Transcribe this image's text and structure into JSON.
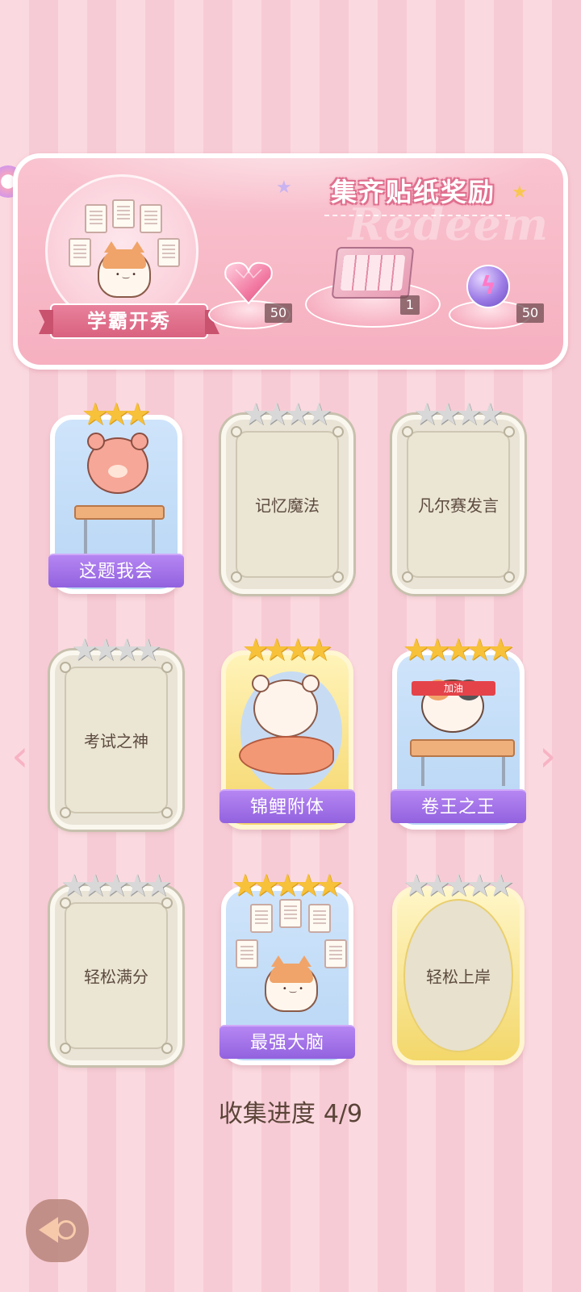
{
  "reward_panel": {
    "title": "集齐贴纸奖励",
    "watermark": "Redeem",
    "featured_sticker_label": "学霸开秀",
    "rewards": [
      {
        "icon": "heart-gem-icon",
        "quantity": "50"
      },
      {
        "icon": "gift-box-icon",
        "quantity": "1"
      },
      {
        "icon": "lightning-orb-icon",
        "quantity": "50"
      }
    ]
  },
  "cards": [
    {
      "label": "这题我会",
      "stars_total": 3,
      "stars_filled": 3,
      "unlocked": true
    },
    {
      "label": "记忆魔法",
      "stars_total": 4,
      "stars_filled": 0,
      "unlocked": false
    },
    {
      "label": "凡尔赛发言",
      "stars_total": 4,
      "stars_filled": 0,
      "unlocked": false
    },
    {
      "label": "考试之神",
      "stars_total": 4,
      "stars_filled": 0,
      "unlocked": false
    },
    {
      "label": "锦鲤附体",
      "stars_total": 4,
      "stars_filled": 4,
      "unlocked": true
    },
    {
      "label": "卷王之王",
      "stars_total": 5,
      "stars_filled": 5,
      "unlocked": true
    },
    {
      "label": "轻松满分",
      "stars_total": 5,
      "stars_filled": 0,
      "unlocked": false
    },
    {
      "label": "最强大脑",
      "stars_total": 5,
      "stars_filled": 5,
      "unlocked": true
    },
    {
      "label": "轻松上岸",
      "stars_total": 5,
      "stars_filled": 0,
      "unlocked": false
    }
  ],
  "card6_headband": "加油",
  "progress": {
    "label": "收集进度",
    "value": "4/9"
  },
  "colors": {
    "accent_purple": "#9262df",
    "star_gold": "#f7c13a",
    "background_pink": "#fbd9e0"
  }
}
